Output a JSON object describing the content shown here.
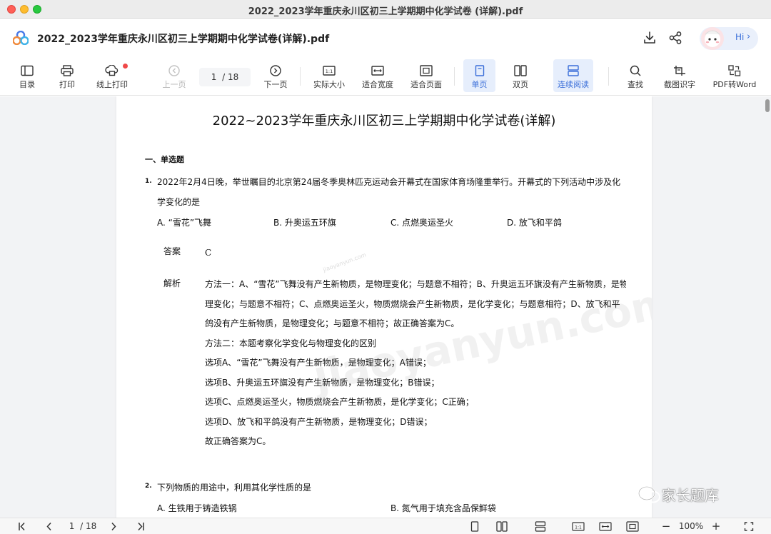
{
  "window": {
    "title": "2022_2023学年重庆永川区初三上学期期中化学试卷 (详解).pdf"
  },
  "header": {
    "doc_title": "2022_2023学年重庆永川区初三上学期期中化学试卷(详解).pdf",
    "assistant_label": "Hi",
    "download_icon": "download-icon",
    "share_icon": "share-icon"
  },
  "toolbar": {
    "toc": "目录",
    "print": "打印",
    "online_print": "线上打印",
    "prev_page": "上一页",
    "page_current": "1",
    "page_sep": "/",
    "page_total": "18",
    "next_page": "下一页",
    "actual_size": "实际大小",
    "fit_width": "适合宽度",
    "fit_page": "适合页面",
    "single_page": "单页",
    "double_page": "双页",
    "continuous": "连续阅读",
    "find": "查找",
    "ocr": "截图识字",
    "to_word": "PDF转Word"
  },
  "page": {
    "title": "2022~2023学年重庆永川区初三上学期期中化学试卷(详解)",
    "section": "一、单选题",
    "q1": {
      "num": "1.",
      "line1": "2022年2月4日晚，举世瞩目的北京第24届冬季奥林匹克运动会开幕式在国家体育场隆重举行。开幕式的下列活动中涉及化",
      "line2": "学变化的是",
      "opt_a": "A. “雪花”飞舞",
      "opt_b": "B. 升奥运五环旗",
      "opt_c": "C. 点燃奥运圣火",
      "opt_d": "D. 放飞和平鸽",
      "answer_label": "答案",
      "answer": "C",
      "analysis_label": "解析",
      "analysis": [
        "方法一：A、“雪花”飞舞没有产生新物质，是物理变化；与题意不相符；B、升奥运五环旗没有产生新物质，是物",
        "理变化；与题意不相符；C、点燃奥运圣火，物质燃烧会产生新物质，是化学变化；与题意相符；D、放飞和平",
        "鸽没有产生新物质，是物理变化；与题意不相符；故正确答案为C。",
        "方法二：本题考察化学变化与物理变化的区别",
        "选项A、“雪花”飞舞没有产生新物质，是物理变化；A错误；",
        "选项B、升奥运五环旗没有产生新物质，是物理变化；B错误；",
        "选项C、点燃奥运圣火，物质燃烧会产生新物质，是化学变化；C正确；",
        "选项D、放飞和平鸽没有产生新物质，是物理变化；D错误；",
        "故正确答案为C。"
      ]
    },
    "q2": {
      "num": "2.",
      "text": "下列物质的用途中，利用其化学性质的是",
      "opt_a": "A. 生铁用于铸造铁锅",
      "opt_b": "B. 氮气用于填充含品保鲜袋"
    },
    "watermark": "jiaoyanyun.com",
    "watermark_small": "jiaoyanyun.com"
  },
  "overlay": {
    "wechat_watermark": "家长题库"
  },
  "bottombar": {
    "page_current": "1",
    "page_sep": "/",
    "page_total": "18",
    "zoom": "100%",
    "zoom_out": "−",
    "zoom_in": "+"
  },
  "colors": {
    "accent": "#3b6fd9",
    "active_bg": "#e6eefc",
    "page_bg": "#f2f3f5"
  }
}
